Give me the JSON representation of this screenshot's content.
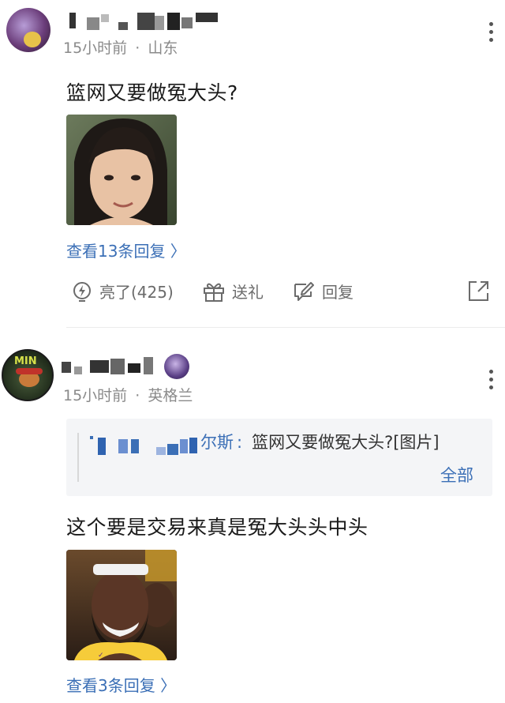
{
  "comments": [
    {
      "time": "15小时前",
      "location": "山东",
      "text": "篮网又要做冤大头?",
      "replies_link": "查看13条回复 〉",
      "actions": {
        "like": "亮了(425)",
        "gift": "送礼",
        "reply": "回复"
      }
    },
    {
      "name_suffix": "尔斯",
      "time": "15小时前",
      "location": "英格兰",
      "quote": {
        "colon": ":",
        "text": "篮网又要做冤大头?[图片]",
        "expand": "全部"
      },
      "text": "这个要是交易来真是冤大头头中头",
      "replies_link": "查看3条回复 〉"
    }
  ],
  "meta_separator": "·",
  "icons": {
    "more": "more-vertical-icon",
    "like": "lightning-bulb-icon",
    "gift": "gift-icon",
    "reply": "edit-reply-icon",
    "share": "share-icon"
  },
  "colors": {
    "link": "#3b6fb6",
    "meta": "#8a8a8a",
    "text": "#1a1a1a"
  }
}
